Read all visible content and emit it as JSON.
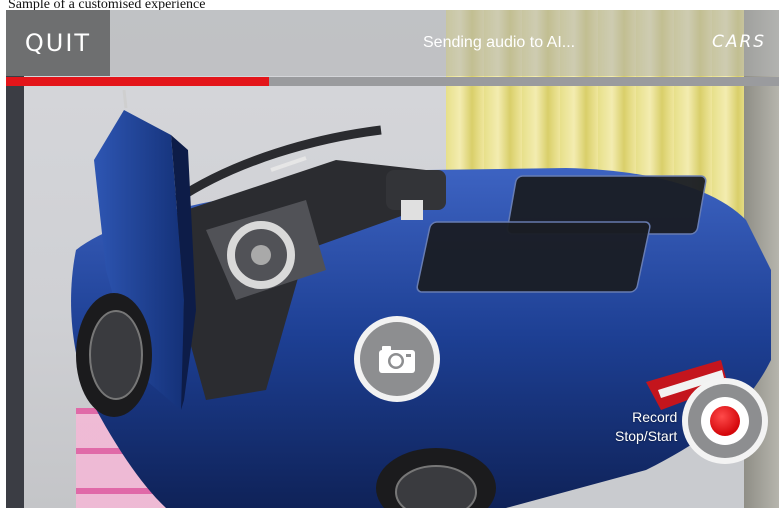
{
  "caption": "Sample of a customised experience",
  "header": {
    "quit_label": "QUIT",
    "status_text": "Sending audio to AI...",
    "cars_label": "CARS"
  },
  "progress": {
    "fraction": 0.34,
    "color": "#e3151a"
  },
  "controls": {
    "capture_icon": "camera-icon",
    "record_label_line1": "Record",
    "record_label_line2": "Stop/Start",
    "record_color": "#d4070b"
  },
  "colors": {
    "car_body": "#1c3f8f",
    "header_button": "#6e6f70",
    "progress_track": "#9a9b9e"
  }
}
